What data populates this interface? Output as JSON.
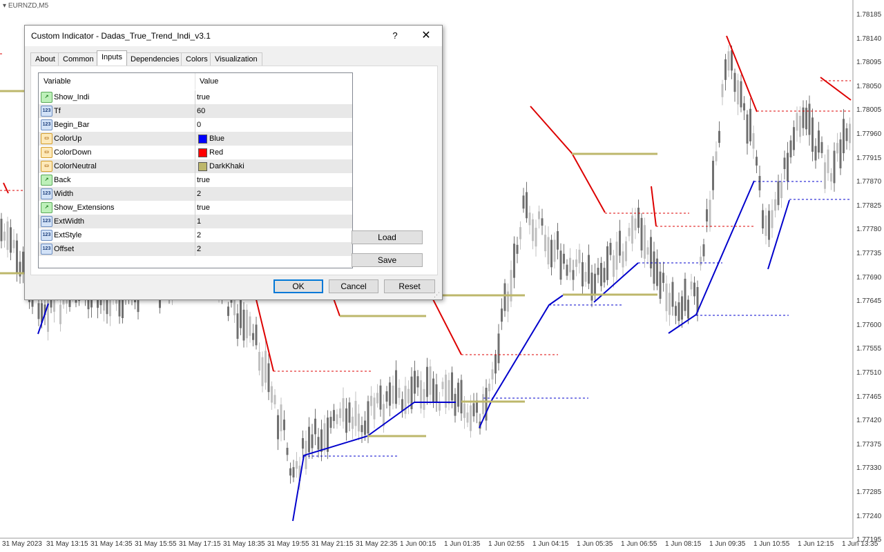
{
  "chart": {
    "symbol": "EURNZD,M5",
    "price_labels": [
      "1.78185",
      "1.78140",
      "1.78095",
      "1.78050",
      "1.78005",
      "1.77960",
      "1.77915",
      "1.77870",
      "1.77825",
      "1.77780",
      "1.77735",
      "1.77690",
      "1.77645",
      "1.77600",
      "1.77555",
      "1.77510",
      "1.77465",
      "1.77420",
      "1.77375",
      "1.77330",
      "1.77285",
      "1.77240",
      "1.77195"
    ],
    "time_labels": [
      "31 May 2023",
      "31 May 13:15",
      "31 May 14:35",
      "31 May 15:55",
      "31 May 17:15",
      "31 May 18:35",
      "31 May 19:55",
      "31 May 21:15",
      "31 May 22:35",
      "1 Jun 00:15",
      "1 Jun 01:35",
      "1 Jun 02:55",
      "1 Jun 04:15",
      "1 Jun 05:35",
      "1 Jun 06:55",
      "1 Jun 08:15",
      "1 Jun 09:35",
      "1 Jun 10:55",
      "1 Jun 12:15",
      "1 Jun 13:35"
    ],
    "colors": {
      "up": "#0000cc",
      "down": "#dd0000",
      "neutral": "#bdb76b",
      "candle_bull": "#c0c0c0",
      "candle_bear": "#707070"
    }
  },
  "dialog": {
    "title": "Custom Indicator - Dadas_True_Trend_Indi_v3.1",
    "help_label": "?",
    "close_label": "✕",
    "tabs": [
      "About",
      "Common",
      "Inputs",
      "Dependencies",
      "Colors",
      "Visualization"
    ],
    "active_tab": "Inputs",
    "grid": {
      "header_variable": "Variable",
      "header_value": "Value",
      "rows": [
        {
          "icon": "bool",
          "name": "Show_Indi",
          "value": "true"
        },
        {
          "icon": "num",
          "name": "Tf",
          "value": "60"
        },
        {
          "icon": "num",
          "name": "Begin_Bar",
          "value": "0"
        },
        {
          "icon": "clr",
          "name": "ColorUp",
          "value": "Blue",
          "swatch": "#0000ff"
        },
        {
          "icon": "clr",
          "name": "ColorDown",
          "value": "Red",
          "swatch": "#ff0000"
        },
        {
          "icon": "clr",
          "name": "ColorNeutral",
          "value": "DarkKhaki",
          "swatch": "#bdb76b"
        },
        {
          "icon": "bool",
          "name": "Back",
          "value": "true"
        },
        {
          "icon": "num",
          "name": "Width",
          "value": "2"
        },
        {
          "icon": "bool",
          "name": "Show_Extensions",
          "value": "true"
        },
        {
          "icon": "num",
          "name": "ExtWidth",
          "value": "1"
        },
        {
          "icon": "num",
          "name": "ExtStyle",
          "value": "2"
        },
        {
          "icon": "num",
          "name": "Offset",
          "value": "2"
        }
      ]
    },
    "buttons": {
      "load": "Load",
      "save": "Save",
      "ok": "OK",
      "cancel": "Cancel",
      "reset": "Reset"
    }
  }
}
